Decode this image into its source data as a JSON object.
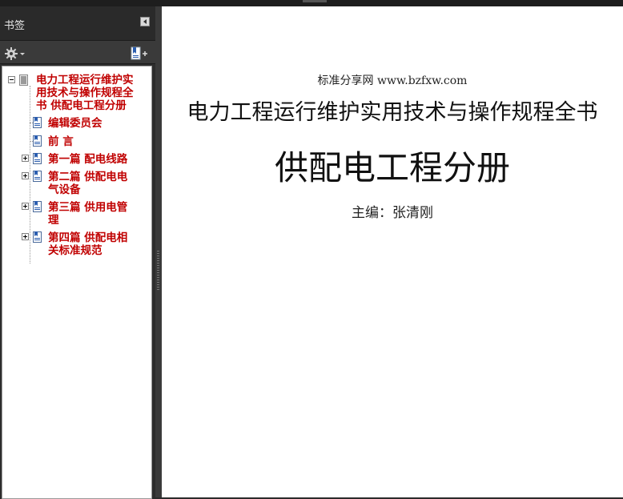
{
  "panel": {
    "title": "书签"
  },
  "bookmarks": [
    {
      "label_lines": [
        "电力工程运行维护实",
        "用技术与操作规程全",
        "书  供配电工程分册"
      ]
    },
    {
      "label_lines": [
        "编辑委员会"
      ]
    },
    {
      "label_lines": [
        "前  言"
      ]
    },
    {
      "label_lines": [
        "第一篇  配电线路"
      ]
    },
    {
      "label_lines": [
        "第二篇  供配电电",
        "气设备"
      ]
    },
    {
      "label_lines": [
        "第三篇  供用电管",
        "理"
      ]
    },
    {
      "label_lines": [
        "第四篇  供配电相",
        "关标准规范"
      ]
    }
  ],
  "document": {
    "site": "标准分享网 www.bzfxw.com",
    "title": "电力工程运行维护实用技术与操作规程全书",
    "subtitle": "供配电工程分册",
    "editor": "主编：张清刚"
  },
  "colors": {
    "bookmark_text": "#c00000",
    "panel_bg": "#2d2d2d"
  }
}
